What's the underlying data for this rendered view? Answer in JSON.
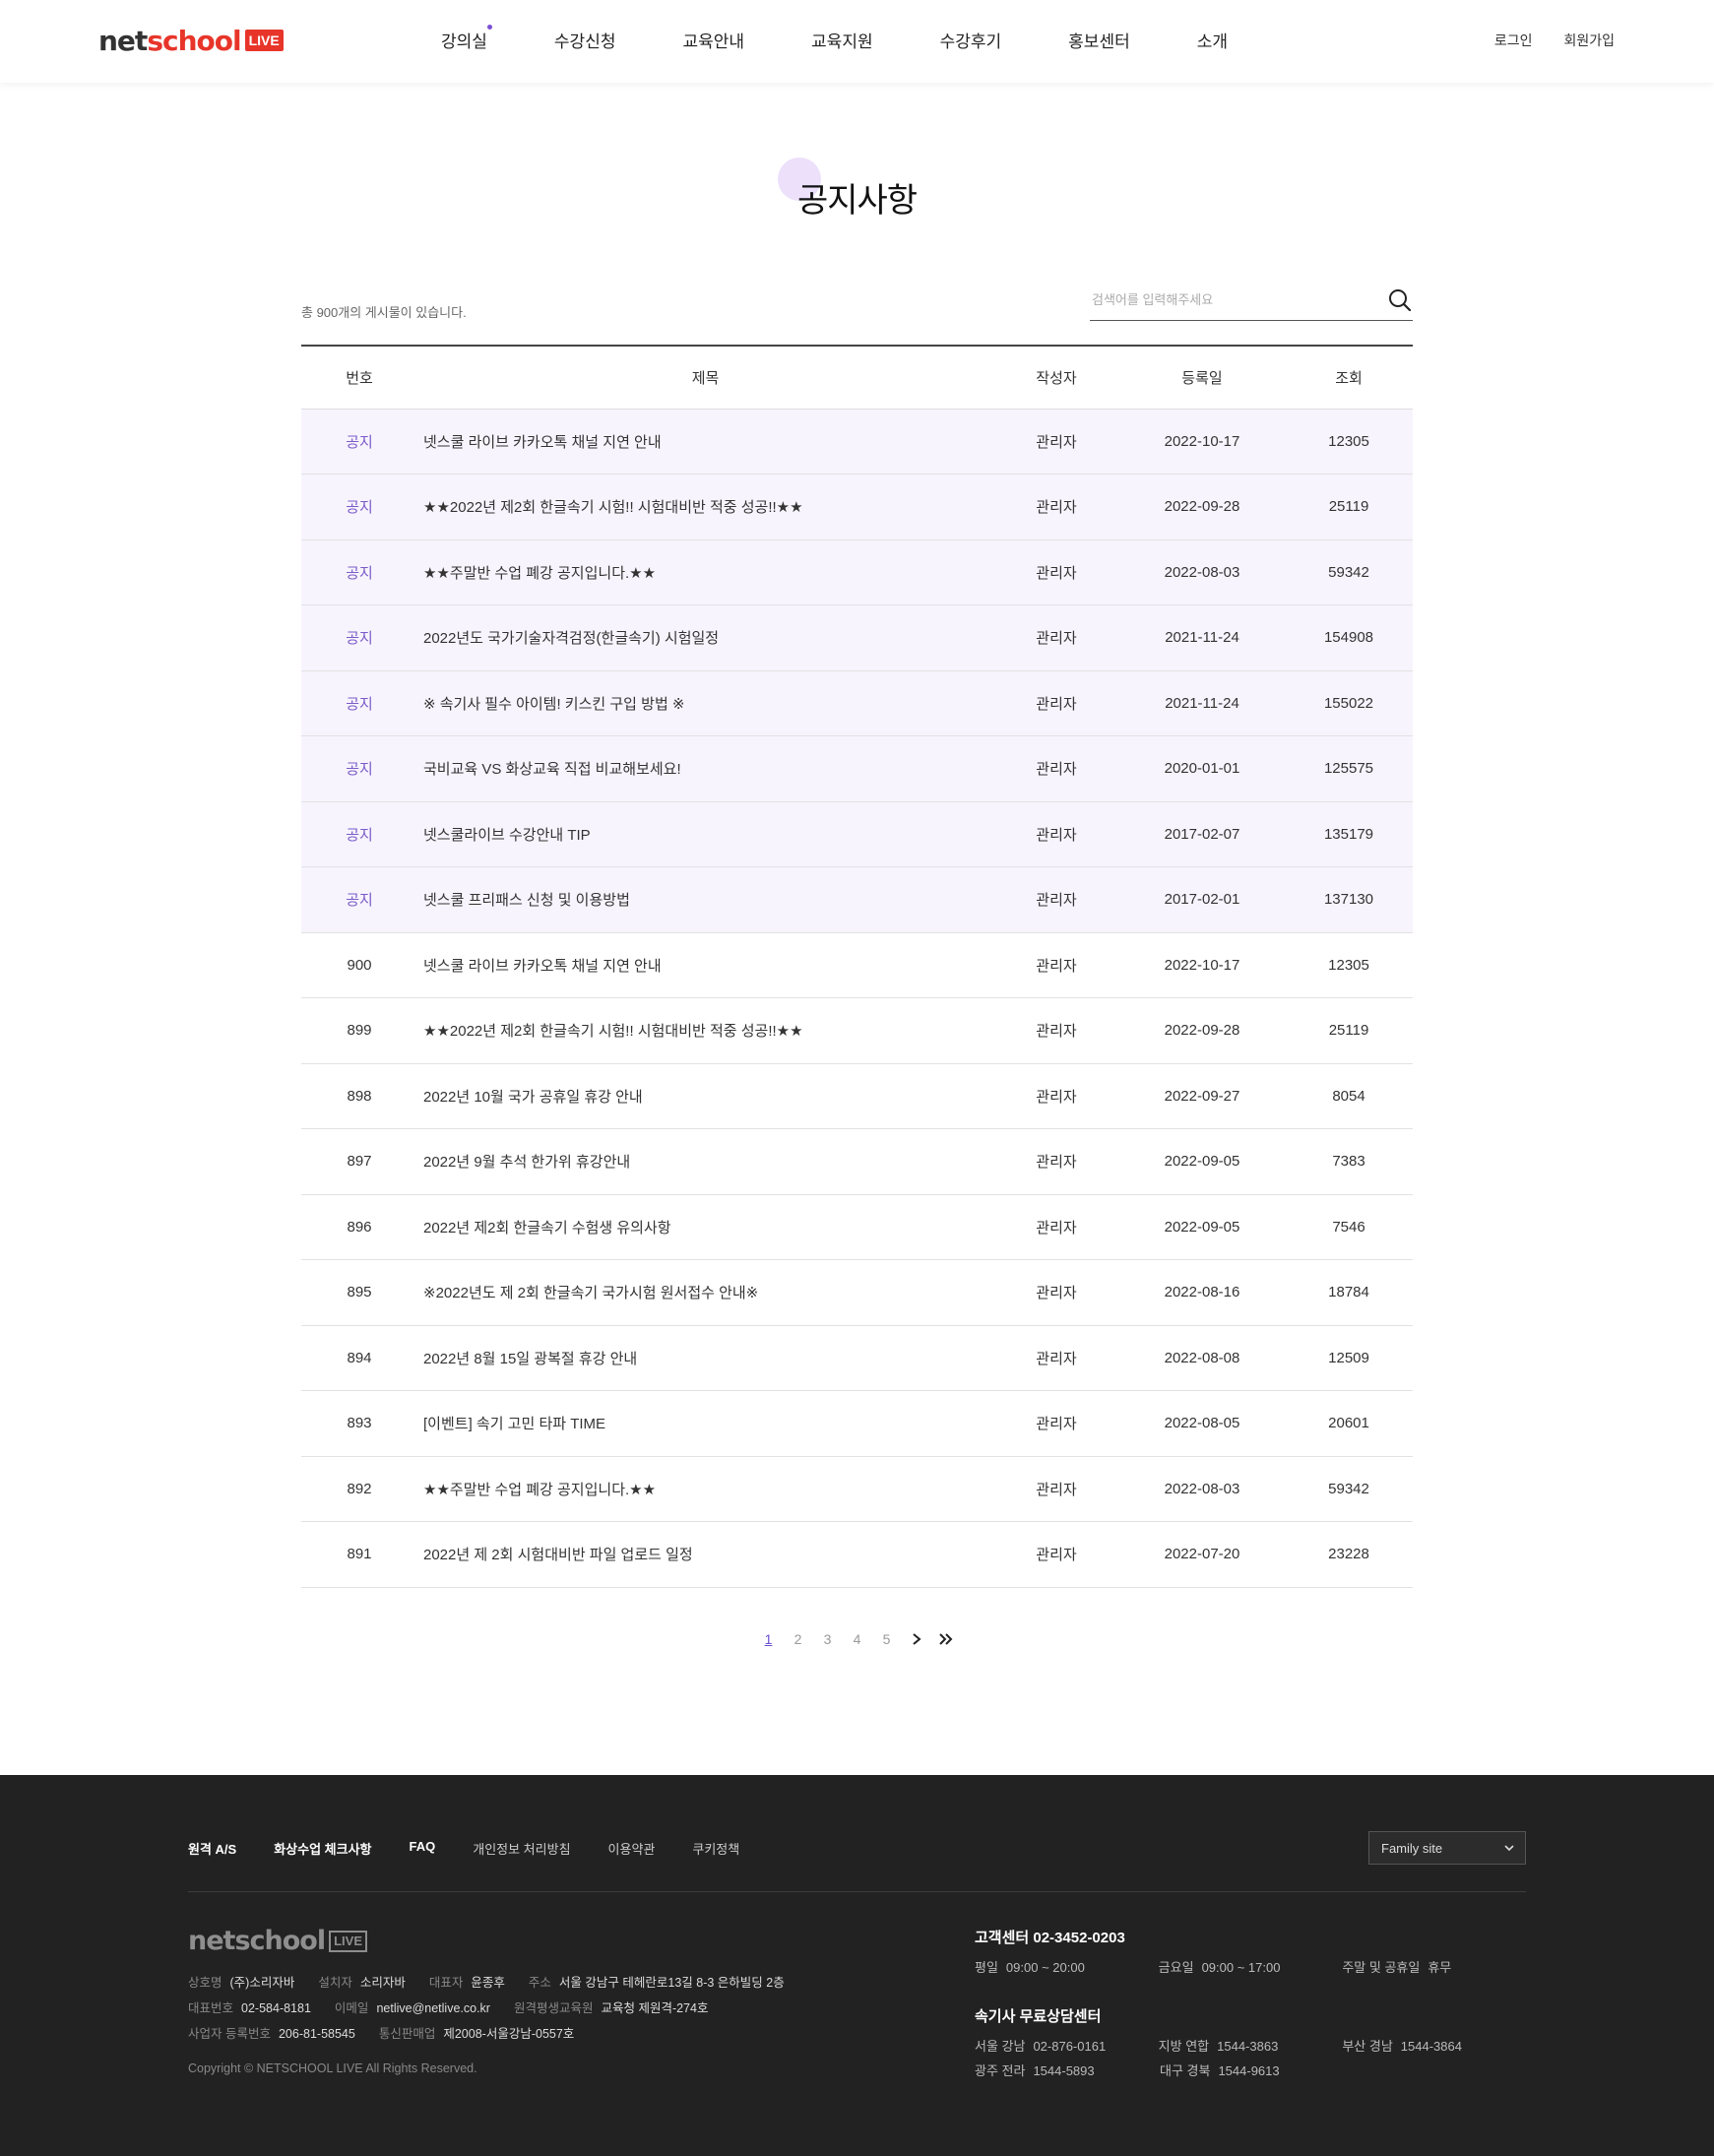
{
  "header": {
    "logo_text_dark": "net",
    "logo_text_red": "school",
    "logo_badge": "LIVE",
    "nav": [
      "강의실",
      "수강신청",
      "교육안내",
      "교육지원",
      "수강후기",
      "홍보센터",
      "소개"
    ],
    "login": "로그인",
    "signup": "회원가입"
  },
  "page": {
    "title": "공지사항"
  },
  "board": {
    "total_text": "총 900개의 게시물이 있습니다.",
    "search_placeholder": "검색어를 입력해주세요",
    "columns": {
      "no": "번호",
      "title": "제목",
      "writer": "작성자",
      "date": "등록일",
      "views": "조회"
    },
    "rows": [
      {
        "no": "공지",
        "title": "넷스쿨 라이브 카카오톡 채널 지연 안내",
        "writer": "관리자",
        "date": "2022-10-17",
        "views": "12305",
        "notice": true
      },
      {
        "no": "공지",
        "title": "★★2022년 제2회 한글속기 시험!! 시험대비반 적중 성공!!★★",
        "writer": "관리자",
        "date": "2022-09-28",
        "views": "25119",
        "notice": true
      },
      {
        "no": "공지",
        "title": "★★주말반 수업 폐강 공지입니다.★★",
        "writer": "관리자",
        "date": "2022-08-03",
        "views": "59342",
        "notice": true
      },
      {
        "no": "공지",
        "title": "2022년도 국가기술자격검정(한글속기) 시험일정",
        "writer": "관리자",
        "date": "2021-11-24",
        "views": "154908",
        "notice": true
      },
      {
        "no": "공지",
        "title": "※ 속기사 필수 아이템! 키스킨 구입 방법 ※",
        "writer": "관리자",
        "date": "2021-11-24",
        "views": "155022",
        "notice": true
      },
      {
        "no": "공지",
        "title": "국비교육 VS 화상교육 직접 비교해보세요!",
        "writer": "관리자",
        "date": "2020-01-01",
        "views": "125575",
        "notice": true
      },
      {
        "no": "공지",
        "title": "넷스쿨라이브 수강안내 TIP",
        "writer": "관리자",
        "date": "2017-02-07",
        "views": "135179",
        "notice": true
      },
      {
        "no": "공지",
        "title": "넷스쿨 프리패스 신청 및 이용방법",
        "writer": "관리자",
        "date": "2017-02-01",
        "views": "137130",
        "notice": true
      },
      {
        "no": "900",
        "title": "넷스쿨 라이브 카카오톡 채널 지연 안내",
        "writer": "관리자",
        "date": "2022-10-17",
        "views": "12305",
        "notice": false
      },
      {
        "no": "899",
        "title": "★★2022년 제2회 한글속기 시험!! 시험대비반 적중 성공!!★★",
        "writer": "관리자",
        "date": "2022-09-28",
        "views": "25119",
        "notice": false
      },
      {
        "no": "898",
        "title": "2022년 10월 국가 공휴일 휴강 안내",
        "writer": "관리자",
        "date": "2022-09-27",
        "views": "8054",
        "notice": false
      },
      {
        "no": "897",
        "title": "2022년 9월 추석 한가위 휴강안내",
        "writer": "관리자",
        "date": "2022-09-05",
        "views": "7383",
        "notice": false
      },
      {
        "no": "896",
        "title": "2022년 제2회 한글속기 수험생 유의사항",
        "writer": "관리자",
        "date": "2022-09-05",
        "views": "7546",
        "notice": false
      },
      {
        "no": "895",
        "title": "※2022년도 제 2회 한글속기 국가시험 원서접수 안내※",
        "writer": "관리자",
        "date": "2022-08-16",
        "views": "18784",
        "notice": false
      },
      {
        "no": "894",
        "title": "2022년 8월 15일 광복절 휴강 안내",
        "writer": "관리자",
        "date": "2022-08-08",
        "views": "12509",
        "notice": false
      },
      {
        "no": "893",
        "title": "[이벤트] 속기 고민 타파 TIME",
        "writer": "관리자",
        "date": "2022-08-05",
        "views": "20601",
        "notice": false
      },
      {
        "no": "892",
        "title": "★★주말반 수업 폐강 공지입니다.★★",
        "writer": "관리자",
        "date": "2022-08-03",
        "views": "59342",
        "notice": false
      },
      {
        "no": "891",
        "title": "2022년 제 2회 시험대비반 파일 업로드 일정",
        "writer": "관리자",
        "date": "2022-07-20",
        "views": "23228",
        "notice": false
      }
    ]
  },
  "pagination": {
    "pages": [
      "1",
      "2",
      "3",
      "4",
      "5"
    ],
    "current": "1",
    "next_icon": "chevron-right-icon",
    "last_icon": "double-chevron-right-icon"
  },
  "footer": {
    "links": [
      {
        "label": "원격 A/S",
        "bold": true
      },
      {
        "label": "화상수업 체크사항",
        "bold": true
      },
      {
        "label": "FAQ",
        "bold": true
      },
      {
        "label": "개인정보 처리방침",
        "bold": false
      },
      {
        "label": "이용약관",
        "bold": false
      },
      {
        "label": "쿠키정책",
        "bold": false
      }
    ],
    "family_site": "Family site",
    "logo_text": "netschool",
    "logo_badge": "LIVE",
    "info_lines": [
      [
        {
          "k": "상호명",
          "v": "(주)소리자바"
        },
        {
          "k": "설치자",
          "v": "소리자바"
        },
        {
          "k": "대표자",
          "v": "윤종후"
        },
        {
          "k": "주소",
          "v": "서울 강남구 테헤란로13길 8-3 은하빌딩 2층"
        }
      ],
      [
        {
          "k": "대표번호",
          "v": "02-584-8181"
        },
        {
          "k": "이메일",
          "v": "netlive@netlive.co.kr"
        },
        {
          "k": "원격평생교육원",
          "v": "교육청 제원격-274호"
        }
      ],
      [
        {
          "k": "사업자 등록번호",
          "v": "206-81-58545"
        },
        {
          "k": "통신판매업",
          "v": "제2008-서울강남-0557호"
        }
      ]
    ],
    "copyright": "Copyright © NETSCHOOL LIVE All Rights Reserved.",
    "cs": {
      "title": "고객센터 02-3452-0203",
      "hours": [
        {
          "k": "평일",
          "v": "09:00 ~ 20:00"
        },
        {
          "k": "금요일",
          "v": "09:00 ~ 17:00"
        },
        {
          "k": "주말 및 공휴일",
          "v": "휴무"
        }
      ],
      "consult_title": "속기사 무료상담센터",
      "consult_row1": [
        {
          "k": "서울 강남",
          "v": "02-876-0161"
        },
        {
          "k": "지방 연합",
          "v": "1544-3863"
        },
        {
          "k": "부산 경남",
          "v": "1544-3864"
        }
      ],
      "consult_row2": [
        {
          "k": "광주 전라",
          "v": "1544-5893"
        },
        {
          "k": "대구 경북",
          "v": "1544-9613"
        }
      ]
    }
  },
  "colors": {
    "brand_red": "#e8352a",
    "accent_purple": "#7b5bc9",
    "notice_bg": "#f7f4fd",
    "footer_bg": "#222222"
  }
}
